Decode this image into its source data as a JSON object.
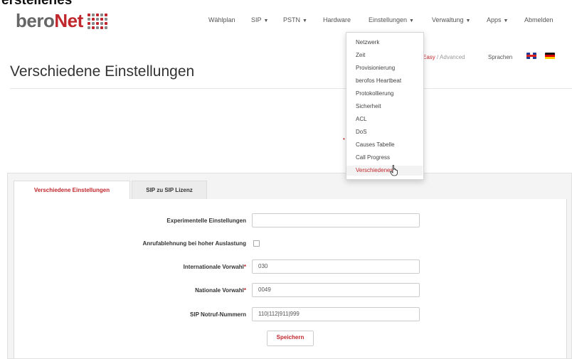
{
  "header_fragment": "erstellenes",
  "brand": {
    "part1": "bero",
    "part2": "Net"
  },
  "nav": {
    "items": [
      {
        "label": "Wählplan",
        "caret": false
      },
      {
        "label": "SIP",
        "caret": true
      },
      {
        "label": "PSTN",
        "caret": true
      },
      {
        "label": "Hardware",
        "caret": false
      },
      {
        "label": "Einstellungen",
        "caret": true
      },
      {
        "label": "Verwaltung",
        "caret": true
      },
      {
        "label": "Apps",
        "caret": true
      },
      {
        "label": "Abmelden",
        "caret": false
      }
    ]
  },
  "dropdown": {
    "items": [
      "Netzwerk",
      "Zeit",
      "Provisionierung",
      "berofos Heartbeat",
      "Protokollierung",
      "Sicherheit",
      "ACL",
      "DoS",
      "Causes Tabelle",
      "Call Progress"
    ],
    "active": "Verschiedenes"
  },
  "mode": {
    "easy": "Easy",
    "separator": " / ",
    "advanced": "Advanced"
  },
  "language": {
    "label": "Sprachen"
  },
  "page_title": "Verschiedene Einstellungen",
  "tabs": [
    "Verschiedene Einstellungen",
    "SIP zu SIP Lizenz"
  ],
  "form": {
    "experimental_label": "Experimentelle Einstellungen",
    "experimental_value": "",
    "reject_label": "Anrufablehnung bei hoher Auslastung",
    "international_label": "Internationale Vorwahl",
    "international_value": "030",
    "national_label": "Nationale Vorwahl",
    "national_value": "0049",
    "emergency_label": "SIP Notruf-Nummern",
    "emergency_value": "110|112|911|999",
    "required_mark": "*",
    "save_label": "Speichern"
  },
  "colors": {
    "accent": "#c0272d",
    "text": "#333333",
    "panel": "#f4f4f4"
  }
}
